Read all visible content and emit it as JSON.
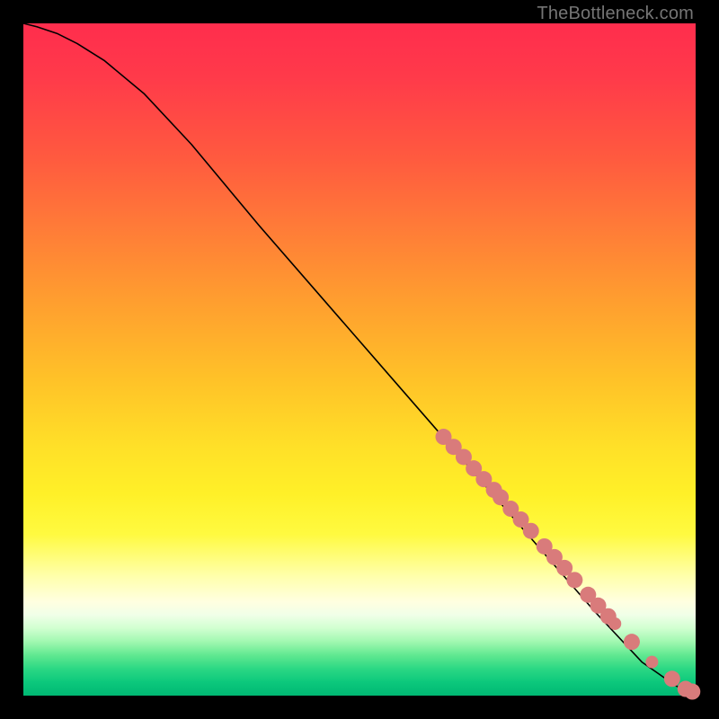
{
  "watermark": "TheBottleneck.com",
  "chart_data": {
    "type": "line",
    "title": "",
    "xlabel": "",
    "ylabel": "",
    "xlim": [
      0,
      1
    ],
    "ylim": [
      0,
      1
    ],
    "grid": false,
    "legend": false,
    "curve": {
      "x": [
        0.0,
        0.02,
        0.05,
        0.08,
        0.12,
        0.18,
        0.25,
        0.35,
        0.45,
        0.55,
        0.65,
        0.75,
        0.85,
        0.92,
        0.97,
        1.0
      ],
      "y": [
        1.0,
        0.995,
        0.985,
        0.97,
        0.945,
        0.895,
        0.82,
        0.7,
        0.585,
        0.47,
        0.355,
        0.24,
        0.125,
        0.05,
        0.015,
        0.0
      ]
    },
    "points": {
      "name": "markers",
      "color": "#d97b7b",
      "radius": 9,
      "x": [
        0.625,
        0.64,
        0.655,
        0.67,
        0.685,
        0.7,
        0.71,
        0.725,
        0.74,
        0.755,
        0.775,
        0.79,
        0.805,
        0.82,
        0.84,
        0.855,
        0.87,
        0.88,
        0.905,
        0.935,
        0.965,
        0.985,
        0.995
      ],
      "y": [
        0.385,
        0.37,
        0.355,
        0.338,
        0.322,
        0.306,
        0.295,
        0.278,
        0.262,
        0.245,
        0.222,
        0.206,
        0.19,
        0.172,
        0.15,
        0.134,
        0.118,
        0.107,
        0.08,
        0.05,
        0.025,
        0.01,
        0.006
      ],
      "radii": [
        9,
        9,
        9,
        9,
        9,
        9,
        9,
        9,
        9,
        9,
        9,
        9,
        9,
        9,
        9,
        9,
        9,
        7,
        9,
        7,
        9,
        9,
        9
      ]
    },
    "background_gradient": {
      "top": "#ff2d4d",
      "mid": "#ffe028",
      "bottom": "#00b873"
    }
  }
}
